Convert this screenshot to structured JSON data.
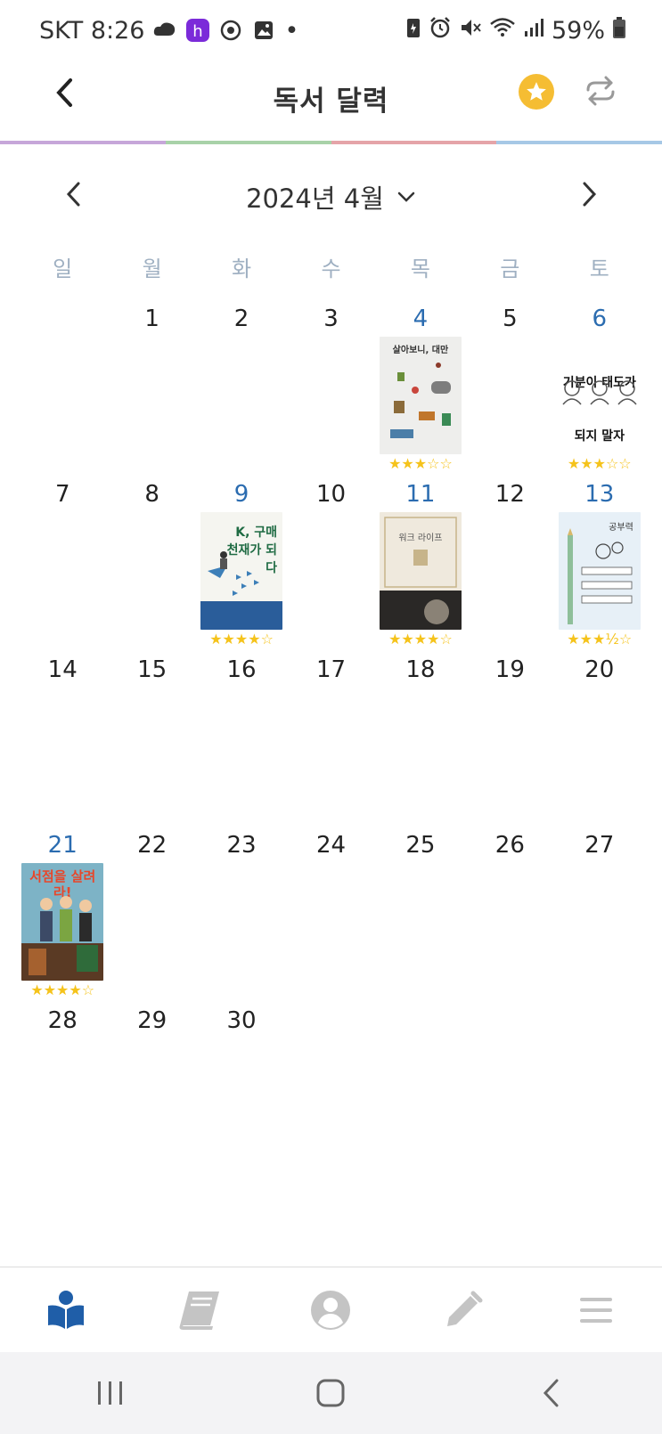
{
  "status_bar": {
    "carrier_time": "SKT 8:26",
    "notif_dot": "•",
    "battery": "59%",
    "icons_left": [
      "cloud-icon",
      "h-app-icon",
      "target-icon",
      "image-icon"
    ],
    "icons_right": [
      "battery-saver-icon",
      "alarm-icon",
      "mute-icon",
      "wifi-icon",
      "signal-icon",
      "battery-icon"
    ]
  },
  "header": {
    "title": "독서 달력"
  },
  "strip_colors": [
    "#c6a6d9",
    "#a8d2a8",
    "#e5a4a8",
    "#a6c8e6"
  ],
  "month_nav": {
    "label": "2024년 4월"
  },
  "weekdays": [
    "일",
    "월",
    "화",
    "수",
    "목",
    "금",
    "토"
  ],
  "days": [
    {
      "n": ""
    },
    {
      "n": "1"
    },
    {
      "n": "2"
    },
    {
      "n": "3"
    },
    {
      "n": "4",
      "book": "a",
      "stars": "★★★☆☆",
      "cover_title": "살아보니, 대만"
    },
    {
      "n": "5"
    },
    {
      "n": "6",
      "book": "b",
      "stars": "★★★☆☆",
      "cover_title": "기분이 태도가 되지 말자"
    },
    {
      "n": "7"
    },
    {
      "n": "8"
    },
    {
      "n": "9",
      "book": "c",
      "stars": "★★★★☆",
      "cover_title": "K, 구매 천재가 되다"
    },
    {
      "n": "10"
    },
    {
      "n": "11",
      "book": "d",
      "stars": "★★★★☆",
      "cover_title": "워크 라이프"
    },
    {
      "n": "12"
    },
    {
      "n": "13",
      "book": "e",
      "stars": "★★★½☆",
      "cover_title": "공부력"
    },
    {
      "n": "14"
    },
    {
      "n": "15"
    },
    {
      "n": "16"
    },
    {
      "n": "17"
    },
    {
      "n": "18"
    },
    {
      "n": "19"
    },
    {
      "n": "20"
    },
    {
      "n": "21",
      "book": "f",
      "stars": "★★★★☆",
      "cover_title": "서점을 살려라!"
    },
    {
      "n": "22"
    },
    {
      "n": "23"
    },
    {
      "n": "24"
    },
    {
      "n": "25"
    },
    {
      "n": "26"
    },
    {
      "n": "27"
    },
    {
      "n": "28"
    },
    {
      "n": "29"
    },
    {
      "n": "30"
    }
  ],
  "bottom_nav": [
    {
      "name": "reading-icon",
      "active": true
    },
    {
      "name": "book-icon",
      "active": false
    },
    {
      "name": "profile-icon",
      "active": false
    },
    {
      "name": "pencil-icon",
      "active": false
    },
    {
      "name": "menu-icon",
      "active": false
    }
  ],
  "colors": {
    "accent": "#1f5ea8",
    "star": "#f5c31b",
    "date_highlight": "#2b6cb0",
    "inactive_icon": "#c4c4c4"
  }
}
